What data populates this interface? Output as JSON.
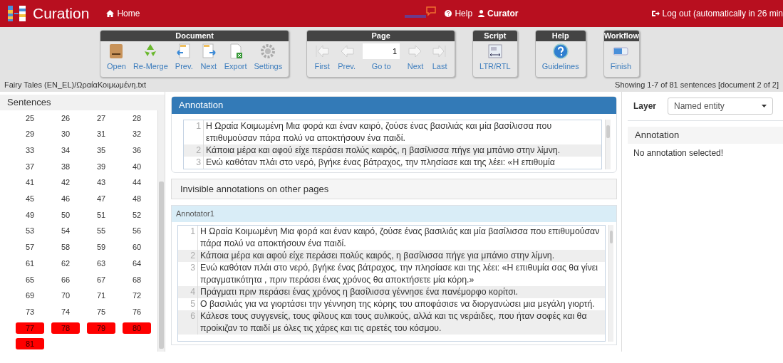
{
  "navbar": {
    "title": "Curation",
    "links": [
      {
        "label": "Home"
      },
      {
        "label": "Help"
      },
      {
        "label": "Curator"
      }
    ],
    "logout": "Log out (automatically in 26 min"
  },
  "toolbar": {
    "groups": [
      {
        "title": "Document",
        "buttons": [
          {
            "label": "Open"
          },
          {
            "label": "Re-Merge"
          },
          {
            "label": "Prev."
          },
          {
            "label": "Next"
          },
          {
            "label": "Export"
          },
          {
            "label": "Settings"
          }
        ]
      },
      {
        "title": "Page",
        "buttons": [
          {
            "label": "First"
          },
          {
            "label": "Prev."
          },
          {
            "label": "Go to",
            "kind": "input",
            "value": "1"
          },
          {
            "label": "Next"
          },
          {
            "label": "Last"
          }
        ]
      },
      {
        "title": "Script",
        "buttons": [
          {
            "label": "LTR/RTL"
          }
        ]
      },
      {
        "title": "Help",
        "buttons": [
          {
            "label": "Guidelines"
          }
        ]
      },
      {
        "title": "Workflow",
        "buttons": [
          {
            "label": "Finish"
          }
        ]
      }
    ]
  },
  "path": "Fairy Tales (EN_EL)/ΩραίαΚοιμωμένη.txt",
  "status": "Showing 1-7 of 81 sentences [document 2 of 2]",
  "sentences": {
    "title": "Sentences",
    "items": [
      {
        "label": "25",
        "conflict": false
      },
      {
        "label": "26",
        "conflict": false
      },
      {
        "label": "27",
        "conflict": false
      },
      {
        "label": "28",
        "conflict": false
      },
      {
        "label": "29",
        "conflict": false
      },
      {
        "label": "30",
        "conflict": false
      },
      {
        "label": "31",
        "conflict": false
      },
      {
        "label": "32",
        "conflict": false
      },
      {
        "label": "33",
        "conflict": false
      },
      {
        "label": "34",
        "conflict": false
      },
      {
        "label": "35",
        "conflict": false
      },
      {
        "label": "36",
        "conflict": false
      },
      {
        "label": "37",
        "conflict": false
      },
      {
        "label": "38",
        "conflict": false
      },
      {
        "label": "39",
        "conflict": false
      },
      {
        "label": "40",
        "conflict": false
      },
      {
        "label": "41",
        "conflict": false
      },
      {
        "label": "42",
        "conflict": false
      },
      {
        "label": "43",
        "conflict": false
      },
      {
        "label": "44",
        "conflict": false
      },
      {
        "label": "45",
        "conflict": false
      },
      {
        "label": "46",
        "conflict": false
      },
      {
        "label": "47",
        "conflict": false
      },
      {
        "label": "48",
        "conflict": false
      },
      {
        "label": "49",
        "conflict": false
      },
      {
        "label": "50",
        "conflict": false
      },
      {
        "label": "51",
        "conflict": false
      },
      {
        "label": "52",
        "conflict": false
      },
      {
        "label": "53",
        "conflict": false
      },
      {
        "label": "54",
        "conflict": false
      },
      {
        "label": "55",
        "conflict": false
      },
      {
        "label": "56",
        "conflict": false
      },
      {
        "label": "57",
        "conflict": false
      },
      {
        "label": "58",
        "conflict": false
      },
      {
        "label": "59",
        "conflict": false
      },
      {
        "label": "60",
        "conflict": false
      },
      {
        "label": "61",
        "conflict": false
      },
      {
        "label": "62",
        "conflict": false
      },
      {
        "label": "63",
        "conflict": false
      },
      {
        "label": "64",
        "conflict": false
      },
      {
        "label": "65",
        "conflict": false
      },
      {
        "label": "66",
        "conflict": false
      },
      {
        "label": "67",
        "conflict": false
      },
      {
        "label": "68",
        "conflict": false
      },
      {
        "label": "69",
        "conflict": false
      },
      {
        "label": "70",
        "conflict": false
      },
      {
        "label": "71",
        "conflict": false
      },
      {
        "label": "72",
        "conflict": false
      },
      {
        "label": "73",
        "conflict": false
      },
      {
        "label": "74",
        "conflict": false
      },
      {
        "label": "75",
        "conflict": false
      },
      {
        "label": "76",
        "conflict": false
      },
      {
        "label": "77",
        "conflict": true
      },
      {
        "label": "78",
        "conflict": true
      },
      {
        "label": "79",
        "conflict": true
      },
      {
        "label": "80",
        "conflict": true
      },
      {
        "label": "81",
        "conflict": true
      }
    ]
  },
  "annotation": {
    "title": "Annotation",
    "lines": [
      {
        "number": "1",
        "text": "Η Ωραία Κοιμωμένη  Μια φορά και έναν καιρό, ζούσε ένας βασιλιάς και μία βασίλισσα που επιθυμούσαν πάρα πολύ να αποκτήσουν ένα παιδί."
      },
      {
        "number": "2",
        "text": "Κάποια μέρα και αφού είχε περάσει πολύς καιρός, η βασίλισσα πήγε για μπάνιο στην λίμνη."
      },
      {
        "number": "3",
        "text": "Ενώ καθόταν πλάι στο νερό, βγήκε ένας βάτραχος, την πλησίασε και της λέει: «Η επιθυμία"
      }
    ]
  },
  "invisible": {
    "title": "Invisible annotations on other pages"
  },
  "annotator": {
    "title": "Annotator1",
    "lines": [
      {
        "number": "1",
        "text": "Η Ωραία Κοιμωμένη  Μια φορά και έναν καιρό, ζούσε ένας βασιλιάς και μία βασίλισσα που επιθυμούσαν πάρα πολύ να αποκτήσουν ένα παιδί."
      },
      {
        "number": "2",
        "text": "Κάποια μέρα και αφού είχε περάσει πολύς καιρός, η βασίλισσα πήγε για μπάνιο στην λίμνη."
      },
      {
        "number": "3",
        "text": "Ενώ καθόταν πλάι στο νερό, βγήκε ένας βάτραχος, την πλησίασε και της λέει: «Η επιθυμία σας θα γίνει πραγματικότητα , πριν περάσει ένας χρόνος θα αποκτήσετε μία κόρη.»"
      },
      {
        "number": "4",
        "text": "Πράγματι πριν περάσει ένας χρόνος η βασίλισσα γέννησε ένα πανέμορφο κορίτσι."
      },
      {
        "number": "5",
        "text": "Ο βασιλιάς για να γιορτάσει την γέννηση της κόρης του αποφάσισε να διοργανώσει μια μεγάλη γιορτή."
      },
      {
        "number": "6",
        "text": "Κάλεσε τους συγγενείς, τους φίλους και τους αυλικούς, αλλά και τις νεράιδες, που ήταν σοφές και θα προίκιζαν το παιδί με όλες τις χάρες και τις αρετές του κόσμου."
      }
    ]
  },
  "layer": {
    "label": "Layer",
    "value": "Named entity"
  },
  "detail": {
    "title": "Annotation",
    "message": "No annotation selected!"
  }
}
